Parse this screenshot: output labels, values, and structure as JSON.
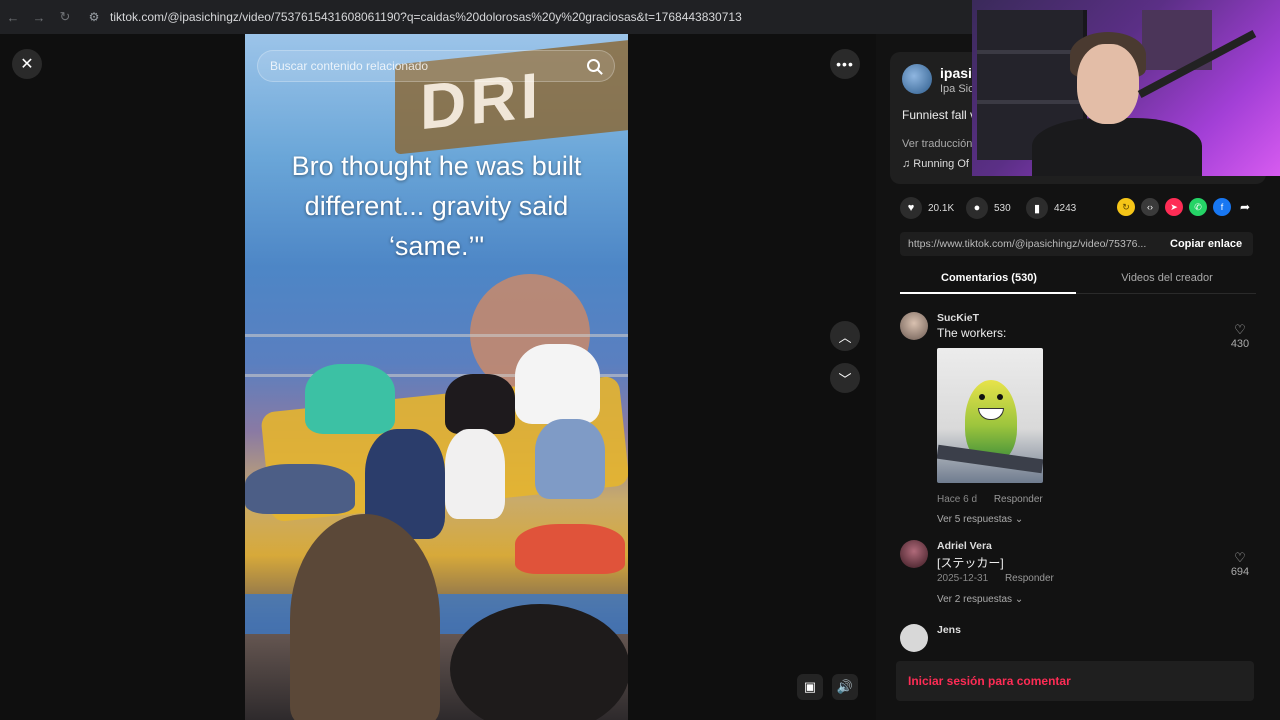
{
  "browser": {
    "back_icon": "arrow-left-icon",
    "forward_icon": "arrow-right-icon",
    "reload_icon": "reload-icon",
    "url": "tiktok.com/@ipasichingz/video/7537615431608061190?q=caidas%20dolorosas%20y%20graciosas&t=1768443830713"
  },
  "player": {
    "search_placeholder": "Buscar contenido relacionado",
    "caption": "Bro thought he was built different... gravity said ‘same.’\"",
    "sign_text": "DRI"
  },
  "post": {
    "author": "ipasi",
    "author_sub": "Ipa Sic",
    "description": "Funniest fall v undefeated\"",
    "translate_label": "Ver traducción",
    "music": "♫ Running Of",
    "likes": "20.1K",
    "comments_count": "530",
    "saves": "4243",
    "link": "https://www.tiktok.com/@ipasichingz/video/75376...",
    "copy_label": "Copiar enlace"
  },
  "tabs": {
    "comments": "Comentarios (530)",
    "creator_videos": "Videos del creador"
  },
  "comments": [
    {
      "user": "SucKieT",
      "text": "The workers:",
      "time": "Hace 6 d",
      "reply": "Responder",
      "replies": "Ver 5 respuestas ⌄",
      "likes": "430"
    },
    {
      "user": "Adriel Vera",
      "text": "[ステッカー]",
      "time": "2025-12-31",
      "reply": "Responder",
      "replies": "Ver 2 respuestas ⌄",
      "likes": "694"
    },
    {
      "user": "Jens",
      "text": "",
      "time": "",
      "reply": "",
      "replies": "",
      "likes": ""
    }
  ],
  "login": {
    "prompt": "Iniciar sesión para comentar"
  },
  "colors": {
    "accent": "#fe2c55",
    "background": "#121212"
  }
}
